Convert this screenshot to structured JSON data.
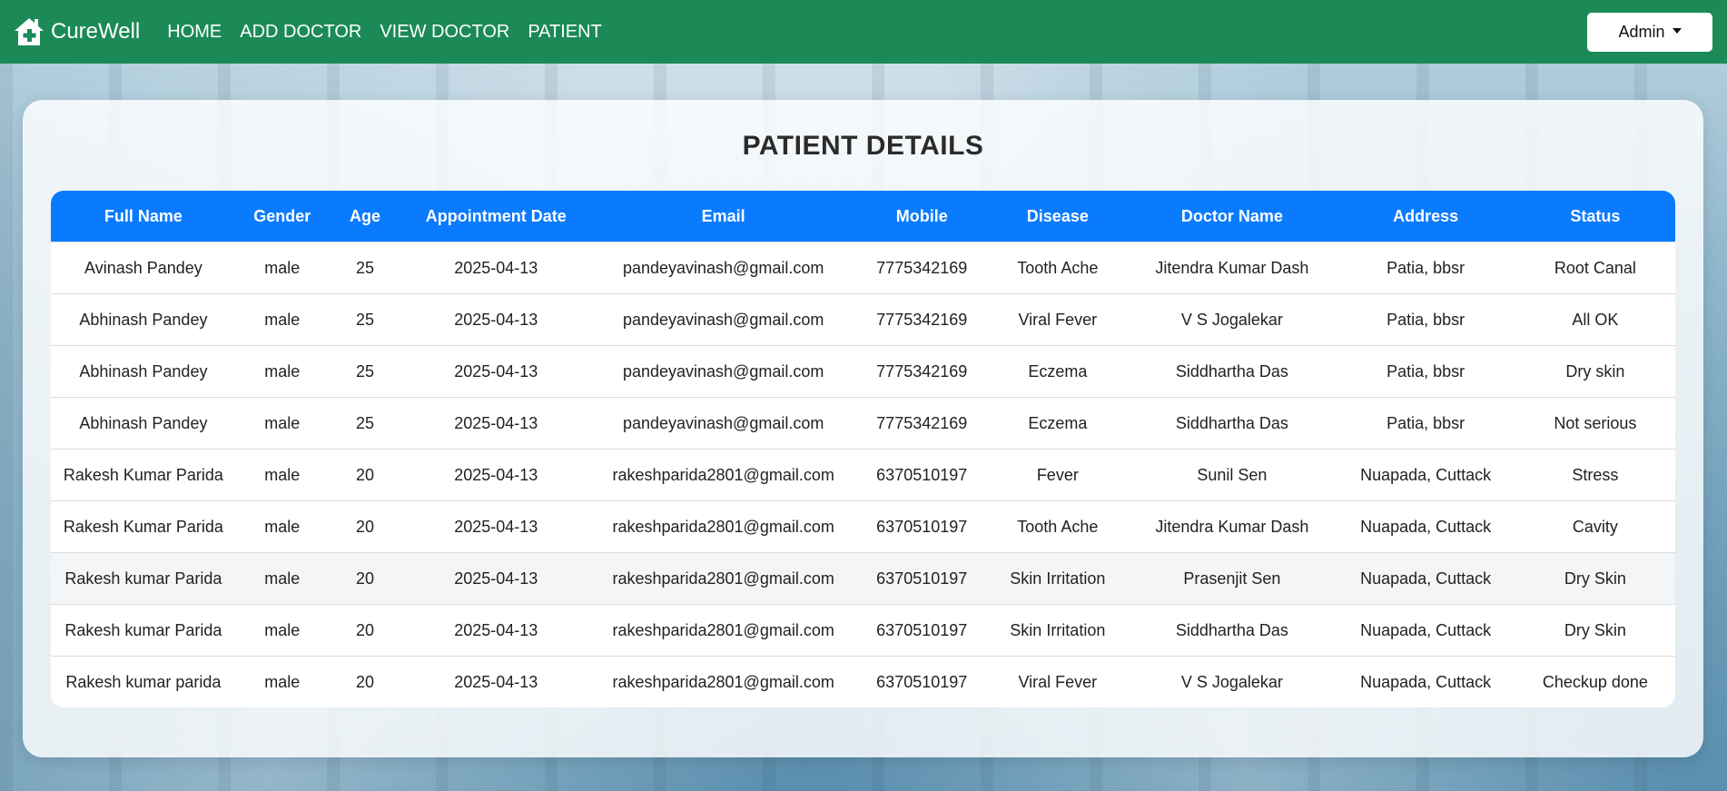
{
  "navbar": {
    "brand": "CureWell",
    "links": [
      "HOME",
      "ADD DOCTOR",
      "VIEW DOCTOR",
      "PATIENT"
    ],
    "admin_label": "Admin",
    "color": "#1b8a57"
  },
  "page": {
    "title": "PATIENT DETAILS"
  },
  "table": {
    "header_color": "#0a7bff",
    "columns": [
      "Full Name",
      "Gender",
      "Age",
      "Appointment Date",
      "Email",
      "Mobile",
      "Disease",
      "Doctor Name",
      "Address",
      "Status"
    ],
    "rows": [
      [
        "Avinash Pandey",
        "male",
        "25",
        "2025-04-13",
        "pandeyavinash@gmail.com",
        "7775342169",
        "Tooth Ache",
        "Jitendra Kumar Dash",
        "Patia, bbsr",
        "Root Canal"
      ],
      [
        "Abhinash Pandey",
        "male",
        "25",
        "2025-04-13",
        "pandeyavinash@gmail.com",
        "7775342169",
        "Viral Fever",
        "V S Jogalekar",
        "Patia, bbsr",
        "All OK"
      ],
      [
        "Abhinash Pandey",
        "male",
        "25",
        "2025-04-13",
        "pandeyavinash@gmail.com",
        "7775342169",
        "Eczema",
        "Siddhartha Das",
        "Patia, bbsr",
        "Dry skin"
      ],
      [
        "Abhinash Pandey",
        "male",
        "25",
        "2025-04-13",
        "pandeyavinash@gmail.com",
        "7775342169",
        "Eczema",
        "Siddhartha Das",
        "Patia, bbsr",
        "Not serious"
      ],
      [
        "Rakesh Kumar Parida",
        "male",
        "20",
        "2025-04-13",
        "rakeshparida2801@gmail.com",
        "6370510197",
        "Fever",
        "Sunil Sen",
        "Nuapada, Cuttack",
        "Stress"
      ],
      [
        "Rakesh Kumar Parida",
        "male",
        "20",
        "2025-04-13",
        "rakeshparida2801@gmail.com",
        "6370510197",
        "Tooth Ache",
        "Jitendra Kumar Dash",
        "Nuapada, Cuttack",
        "Cavity"
      ],
      [
        "Rakesh kumar Parida",
        "male",
        "20",
        "2025-04-13",
        "rakeshparida2801@gmail.com",
        "6370510197",
        "Skin Irritation",
        "Prasenjit Sen",
        "Nuapada, Cuttack",
        "Dry Skin"
      ],
      [
        "Rakesh kumar Parida",
        "male",
        "20",
        "2025-04-13",
        "rakeshparida2801@gmail.com",
        "6370510197",
        "Skin Irritation",
        "Siddhartha Das",
        "Nuapada, Cuttack",
        "Dry Skin"
      ],
      [
        "Rakesh kumar parida",
        "male",
        "20",
        "2025-04-13",
        "rakeshparida2801@gmail.com",
        "6370510197",
        "Viral Fever",
        "V S Jogalekar",
        "Nuapada, Cuttack",
        "Checkup done"
      ]
    ]
  }
}
